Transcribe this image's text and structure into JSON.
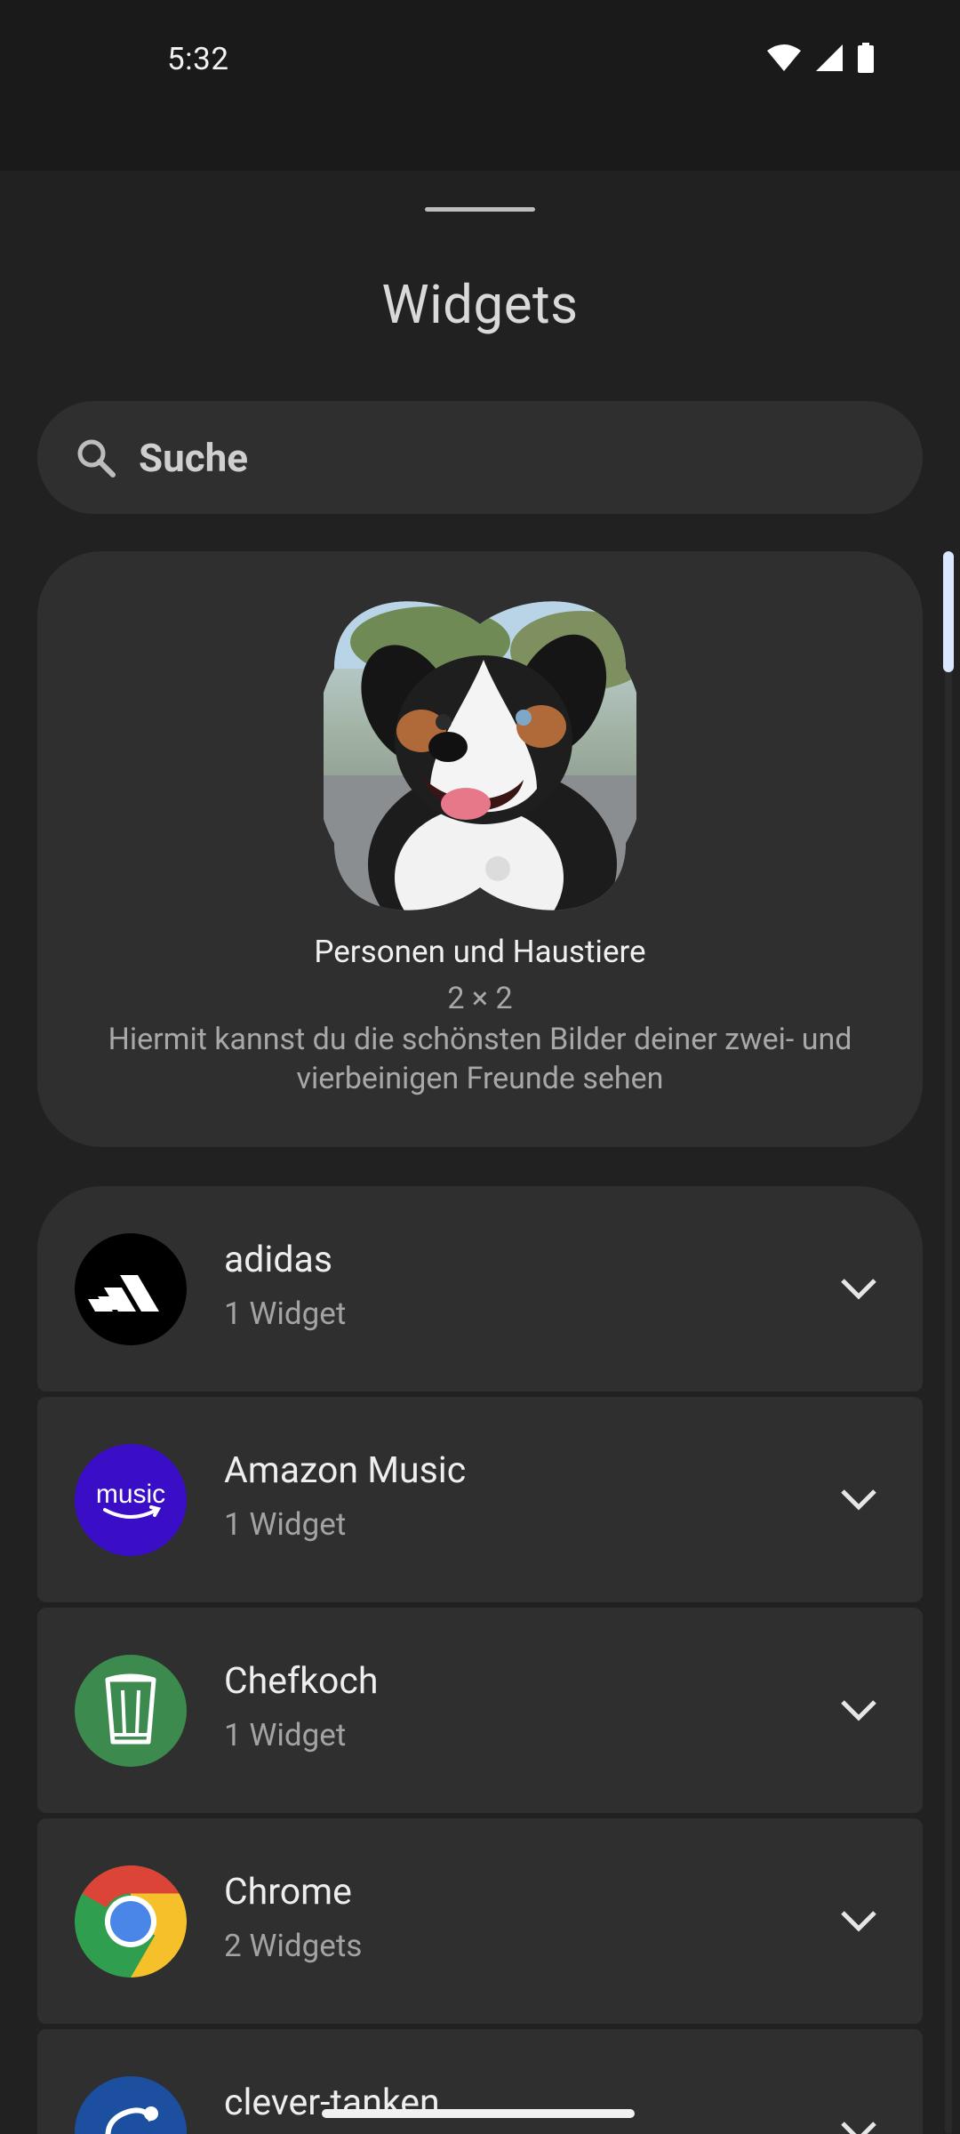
{
  "status_bar": {
    "time": "5:32",
    "icons": [
      "wifi-icon",
      "signal-icon",
      "battery-icon"
    ]
  },
  "sheet": {
    "title": "Widgets"
  },
  "search": {
    "placeholder": "Suche"
  },
  "featured_widget": {
    "title": "Personen und Haustiere",
    "size": "2 × 2",
    "description": "Hiermit kannst du die schönsten Bilder deiner zwei- und vierbeinigen Freunde sehen"
  },
  "apps": [
    {
      "name": "adidas",
      "count": "1 Widget",
      "icon": "adidas-logo-icon"
    },
    {
      "name": "Amazon Music",
      "count": "1 Widget",
      "icon": "amazon-music-icon"
    },
    {
      "name": "Chefkoch",
      "count": "1 Widget",
      "icon": "chefkoch-icon"
    },
    {
      "name": "Chrome",
      "count": "2 Widgets",
      "icon": "chrome-icon"
    },
    {
      "name": "clever-tanken",
      "count": "",
      "icon": "clever-tanken-icon"
    }
  ],
  "colors": {
    "sheet_bg": "#212121",
    "card_bg": "#2f2f2f",
    "amazon_music": "#3a0ec6",
    "chefkoch": "#3c8a4e",
    "scrollbar_thumb": "#dbe6ff"
  }
}
